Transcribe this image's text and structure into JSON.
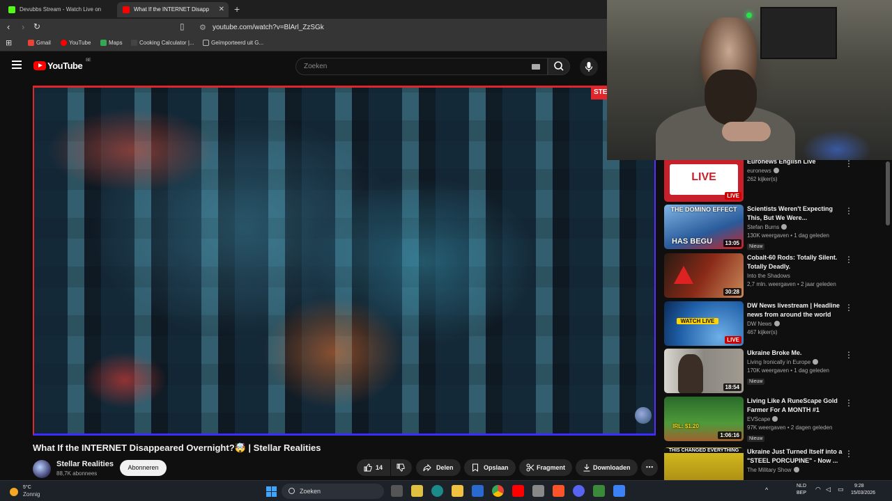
{
  "tabs": [
    {
      "title": "Devubbs Stream - Watch Live on",
      "favicon_color": "#53fc18"
    },
    {
      "title": "What If the INTERNET Disapp",
      "favicon_color": "#ff0000"
    }
  ],
  "toolbar": {
    "url": "youtube.com/watch?v=BlArl_ZzSGk"
  },
  "bookmarks": [
    {
      "label": "Gmail",
      "color": "#ea4335"
    },
    {
      "label": "YouTube",
      "color": "#ff0000"
    },
    {
      "label": "Maps",
      "color": "#34a853"
    },
    {
      "label": "Cooking Calculator |...",
      "color": "#444444"
    },
    {
      "label": "Geïmporteerd uit G...",
      "color": "#999999"
    }
  ],
  "youtube": {
    "logo": "YouTube",
    "country": "BE",
    "search_placeholder": "Zoeken"
  },
  "video": {
    "overlay_tag": "STEL",
    "title": "What If the INTERNET Disappeared Overnight?🤯 | Stellar Realities",
    "channel": "Stellar Realities",
    "subscribers": "88,7K abonnees",
    "subscribe_label": "Abonneren",
    "likes": "14",
    "share": "Delen",
    "save": "Opslaan",
    "clip": "Fragment",
    "download": "Downloaden"
  },
  "sidebar": [
    {
      "title": "Euronews English Live",
      "channel": "euronews",
      "verified": true,
      "views": "262 kijker(s)",
      "badge": "LIVE",
      "new": "",
      "thumb_text": "LIVE",
      "thumb_bg": "#c8202a"
    },
    {
      "title": "Scientists Weren't Expecting This, But We Were...",
      "channel": "Stefan Burns",
      "verified": true,
      "views": "130K weergaven • 1 dag geleden",
      "badge": "13:05",
      "new": "Nieuw",
      "thumb_text": "THE DOMINO EFFECT",
      "thumb_text2": "HAS BEGU",
      "thumb_bg": "#3a6fb0"
    },
    {
      "title": "Cobalt-60 Rods: Totally Silent. Totally Deadly.",
      "channel": "Into the Shadows",
      "verified": false,
      "views": "2,7 mln. weergaven • 2 jaar geleden",
      "badge": "30:28",
      "new": "",
      "thumb_text": "",
      "thumb_bg": "#7a1c14"
    },
    {
      "title": "DW News livestream | Headline news from around the world",
      "channel": "DW News",
      "verified": true,
      "views": "467 kijker(s)",
      "badge": "LIVE",
      "new": "",
      "thumb_text": "WATCH LIVE",
      "thumb_bg": "#1f5fa8"
    },
    {
      "title": "Ukraine Broke Me.",
      "channel": "Living Ironically in Europe",
      "verified": true,
      "views": "170K weergaven • 1 dag geleden",
      "badge": "18:54",
      "new": "Nieuw",
      "thumb_text": "",
      "thumb_bg": "#6b6b68"
    },
    {
      "title": "Living Like A RuneScape Gold Farmer For A MONTH #1",
      "channel": "EVScape",
      "verified": true,
      "views": "97K weergaven • 2 dagen geleden",
      "badge": "1:06:16",
      "new": "Nieuw",
      "thumb_text": "IRL: $1.20",
      "thumb_bg": "#2f6b2a"
    },
    {
      "title": "Ukraine Just Turned Itself into a \"STEEL PORCUPINE\" - Now ...",
      "channel": "The Military Show",
      "verified": true,
      "views": "",
      "badge": "",
      "new": "",
      "thumb_text": "THIS CHANGED EVERYTHING",
      "thumb_bg": "#b6a020"
    }
  ],
  "taskbar": {
    "temperature": "5°C",
    "condition": "Zonnig",
    "search": "Zoeken",
    "lang1": "NLD",
    "lang2": "BEP",
    "time": "9:28",
    "date": "15/03/2026"
  }
}
